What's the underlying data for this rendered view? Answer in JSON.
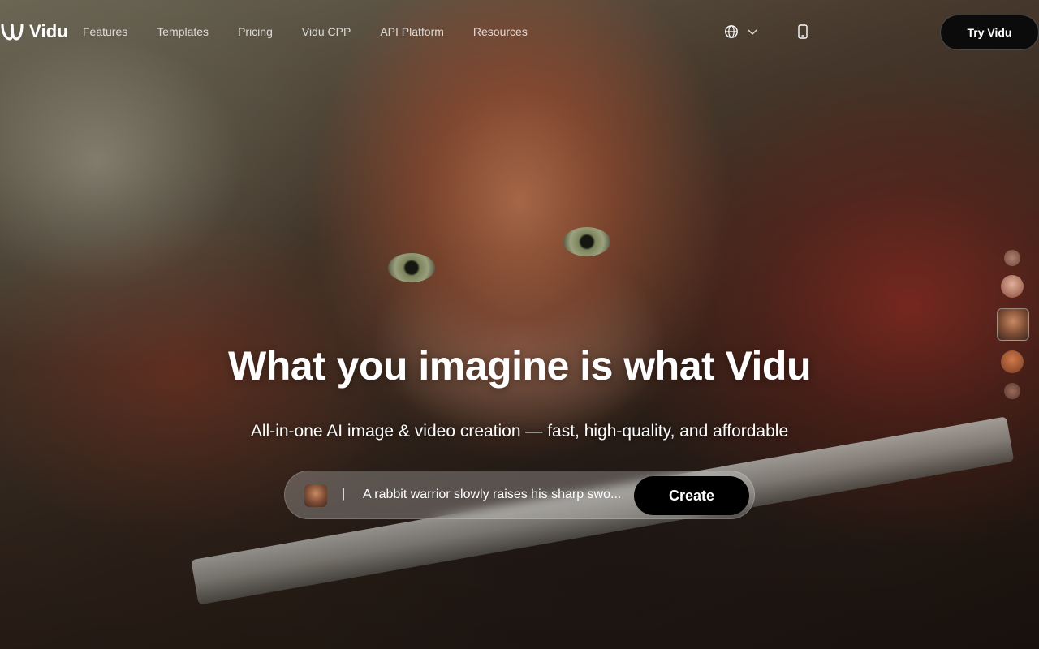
{
  "brand": {
    "name": "Vidu"
  },
  "nav": {
    "links": [
      "Features",
      "Templates",
      "Pricing",
      "Vidu CPP",
      "API Platform",
      "Resources"
    ],
    "language_icon": "globe-icon",
    "dropdown_icon": "chevron-down-icon",
    "device_icon": "mobile-phone-icon",
    "cta_label": "Try Vidu"
  },
  "hero": {
    "headline": "What you imagine is what Vidu",
    "subline": "All-in-one AI image & video creation — fast, high-quality, and affordable",
    "prompt": {
      "caret": "|",
      "text": "A rabbit warrior slowly raises his sharp swo...",
      "button_label": "Create"
    }
  },
  "rail": {
    "thumbnails": [
      {
        "name": "thumb-1",
        "active": false
      },
      {
        "name": "thumb-2",
        "active": false
      },
      {
        "name": "thumb-3",
        "active": true
      },
      {
        "name": "thumb-4",
        "active": false
      },
      {
        "name": "thumb-5",
        "active": false
      }
    ]
  },
  "colors": {
    "cta_background": "#0b0b0b",
    "create_background": "#000000",
    "text": "#ffffff"
  }
}
